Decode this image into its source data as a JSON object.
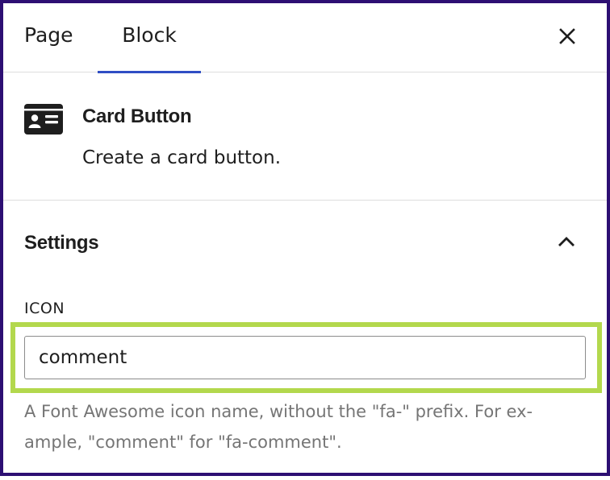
{
  "tabs": {
    "page_label": "Page",
    "block_label": "Block",
    "active": "Block"
  },
  "block": {
    "icon": "id-card-icon",
    "title": "Card Button",
    "description": "Create a card button."
  },
  "settings": {
    "title": "Settings",
    "expanded": true,
    "icon_field": {
      "label": "ICON",
      "value": "comment",
      "help": "A Font Awesome icon name, without the \"fa-\" prefix. For ex-ample, \"comment\" for \"fa-comment\"."
    }
  },
  "colors": {
    "frame_border": "#2d0f73",
    "tab_underline": "#2f4ec4",
    "highlight": "#b3d84d",
    "help_text": "#757575"
  }
}
